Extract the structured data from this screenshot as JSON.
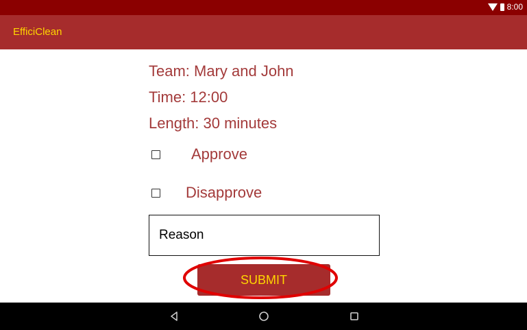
{
  "status_bar": {
    "time": "8:00",
    "wifi_icon": "wifi-icon",
    "battery_icon": "battery-icon"
  },
  "app_bar": {
    "title": "EfficiClean"
  },
  "info": {
    "team": "Team: Mary and John",
    "time": "Time: 12:00",
    "length": "Length: 30 minutes"
  },
  "options": {
    "approve_label": "Approve",
    "approve_checked": false,
    "disapprove_label": "Disapprove",
    "disapprove_checked": false
  },
  "reason": {
    "placeholder": "Reason",
    "value": ""
  },
  "submit": {
    "label": "SUBMIT"
  },
  "annotation": {
    "color": "#e00000",
    "shape": "ellipse"
  },
  "nav_bar": {
    "back_icon": "back-icon",
    "home_icon": "home-icon",
    "recents_icon": "recents-icon"
  },
  "colors": {
    "primary": "#a62c2c",
    "status_bar": "#8b0000",
    "accent": "#ffd600",
    "label_text": "#a33a3a"
  }
}
